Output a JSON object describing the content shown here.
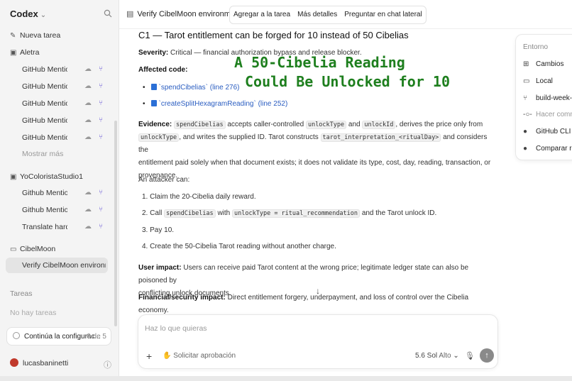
{
  "sidebar": {
    "app_name": "Codex",
    "new_task": "Nueva tarea",
    "projects": [
      {
        "name": "Aletra",
        "items": [
          "GitHub Mentio",
          "GitHub Mentio",
          "GitHub Mentio",
          "GitHub Mentio",
          "GitHub Mentio"
        ],
        "show_more": "Mostrar más"
      },
      {
        "name": "YoColoristaStudio1",
        "items": [
          "Github Mentio",
          "Github Mentio",
          "Translate hardc"
        ]
      },
      {
        "name": "CibelMoon",
        "items": [
          "Verify CibelMoon environm"
        ]
      }
    ],
    "tasks_label": "Tareas",
    "no_tasks": "No hay tareas",
    "task_card": {
      "label": "Continúa la configurac...",
      "count": "0 de 5"
    },
    "user": "lucasbaninetti"
  },
  "topbar": {
    "title": "Verify CibelMoon environmen",
    "actions": [
      "Agregar a la tarea",
      "Más detalles",
      "Preguntar en chat lateral"
    ]
  },
  "content": {
    "heading": "C1 — Tarot entitlement can be forged for 10 instead of 50 Cibelias",
    "severity_label": "Severity:",
    "severity_text": "Critical — financial authorization bypass and release blocker.",
    "affected_label": "Affected code:",
    "affected": [
      {
        "code": "spendCibelias",
        "lines": "(line 276)"
      },
      {
        "code": "createSplitHexagramReading",
        "lines": "(line 252)"
      }
    ],
    "evidence_label": "Evidence:",
    "evidence": {
      "code1": "spendCibelias",
      "t1": "accepts caller-controlled",
      "code2": "unlockType",
      "t2": "and",
      "code3": "unlockId",
      "t3": ", derives the price only from",
      "code4": "unlockType",
      "t4": ", and writes the supplied ID. Tarot constructs",
      "code5": "tarot_interpretation_<ritualDay>",
      "t5": "and considers the",
      "line3": "entitlement paid solely when that document exists; it does not validate its type, cost, day, reading, transaction, or",
      "line4": "provenance."
    },
    "attacker_intro": "An attacker can:",
    "steps": {
      "s1": "1. Claim the 20-Cibelia daily reward.",
      "s2_pre": "2. Call",
      "s2_code1": "spendCibelias",
      "s2_mid": "with",
      "s2_code2": "unlockType = ritual_recommendation",
      "s2_post": "and the Tarot unlock ID.",
      "s3": "3. Pay 10.",
      "s4": "4. Create the 50-Cibelia Tarot reading without another charge."
    },
    "user_impact_label": "User impact:",
    "user_impact_text": "Users can receive paid Tarot content at the wrong price; legitimate ledger state can also be poisoned by",
    "user_impact_text2": "conflicting unlock documents.",
    "fin_impact_label": "Financial/security impact:",
    "fin_impact_text": "Direct entitlement forgery, underpayment, and loss of control over the Cibelia economy."
  },
  "overlay": {
    "line1": "A 50-Cibelia Reading",
    "line2": "Could Be Unlocked for 10",
    "color": "#1e7f1e"
  },
  "environment": {
    "title": "Entorno",
    "items": [
      {
        "label": "Cambios",
        "icon": "diff-icon"
      },
      {
        "label": "Local",
        "icon": "laptop-icon"
      },
      {
        "label": "build-week-",
        "icon": "branch-icon"
      },
      {
        "label": "Hacer comm",
        "icon": "commit-icon"
      },
      {
        "label": "GitHub CLI n",
        "icon": "github-icon"
      },
      {
        "label": "Comparar ra",
        "icon": "github-icon"
      }
    ]
  },
  "composer": {
    "placeholder": "Haz lo que quieras",
    "approval": "Solicitar aprobación",
    "model": "5.6 Sol",
    "effort": "Alto"
  }
}
